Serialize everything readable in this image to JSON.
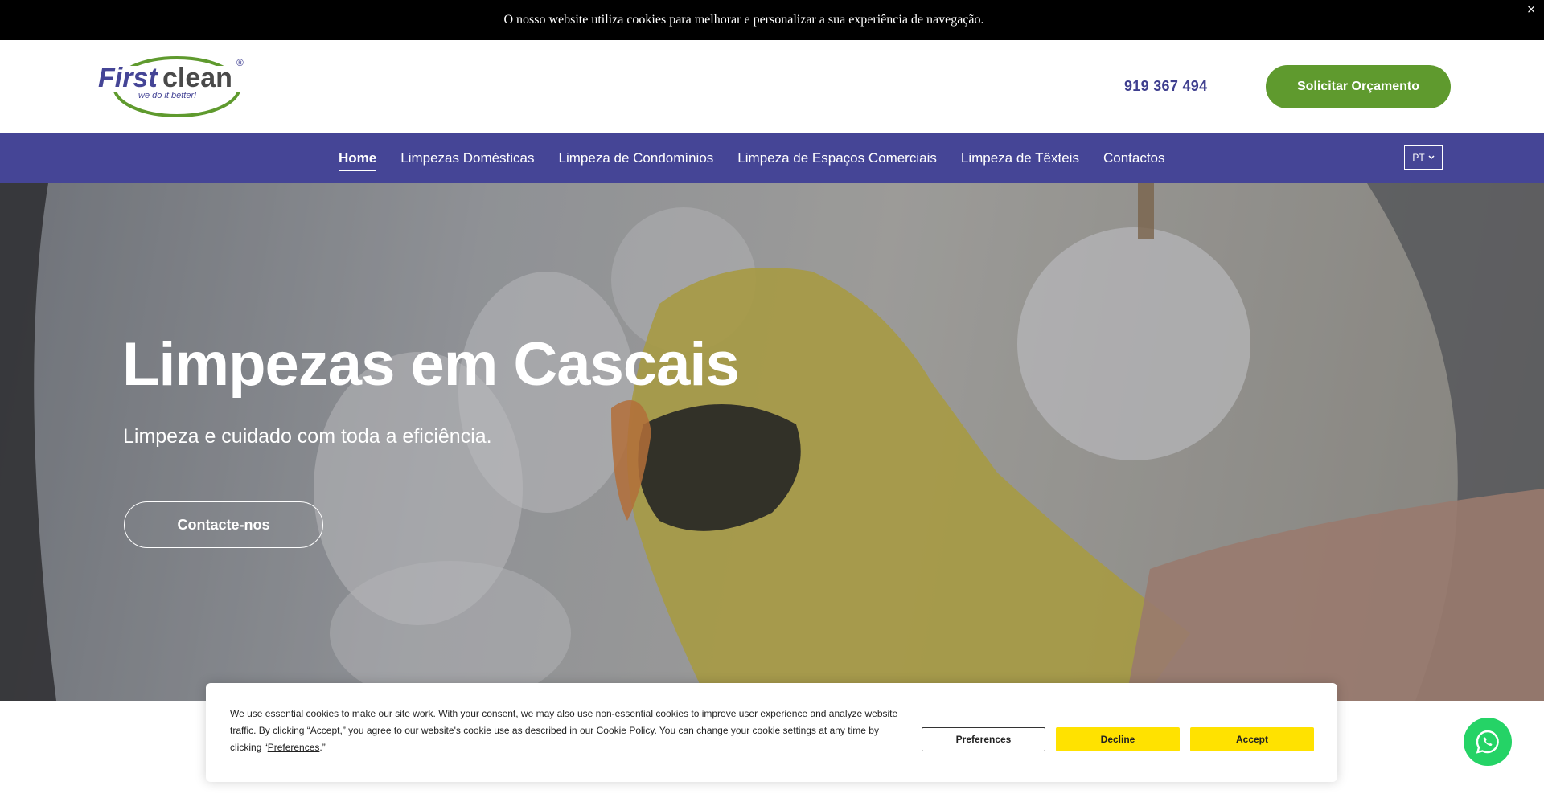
{
  "cookie_bar": {
    "message": "O nosso website utiliza cookies para melhorar e personalizar a sua experiência de navegação.",
    "close": "×"
  },
  "header": {
    "logo": {
      "brand_first": "First",
      "brand_second": "clean",
      "tagline": "we do it better!",
      "registered": "®"
    },
    "phone": "919 367 494",
    "quote_button": "Solicitar Orçamento"
  },
  "nav": {
    "items": [
      {
        "label": "Home",
        "active": true
      },
      {
        "label": "Limpezas Domésticas"
      },
      {
        "label": "Limpeza de Condomínios"
      },
      {
        "label": "Limpeza de Espaços Comerciais"
      },
      {
        "label": "Limpeza de Têxteis"
      },
      {
        "label": "Contactos"
      }
    ],
    "language": "PT"
  },
  "hero": {
    "title": "Limpezas em Cascais",
    "subtitle": "Limpeza e cuidado com toda a eficiência.",
    "cta": "Contacte-nos"
  },
  "consent": {
    "text_1": "We use essential cookies to make our site work. With your consent, we may also use non-essential cookies to improve user experience and analyze website traffic. By clicking “Accept,” you agree to our website's cookie use as described in our ",
    "cookie_policy_link": "Cookie Policy",
    "text_2": ". You can change your cookie settings at any time by clicking “",
    "preferences_link": "Preferences",
    "text_3": ".”",
    "preferences_button": "Preferences",
    "decline_button": "Decline",
    "accept_button": "Accept"
  },
  "colors": {
    "nav_bg": "#454596",
    "brand_green": "#5f9a2e",
    "phone_text": "#3f3f8f",
    "consent_button": "#ffe200",
    "whatsapp": "#25d366"
  },
  "icons": {
    "whatsapp": "whatsapp-icon",
    "language_caret": "chevron-down-icon"
  }
}
